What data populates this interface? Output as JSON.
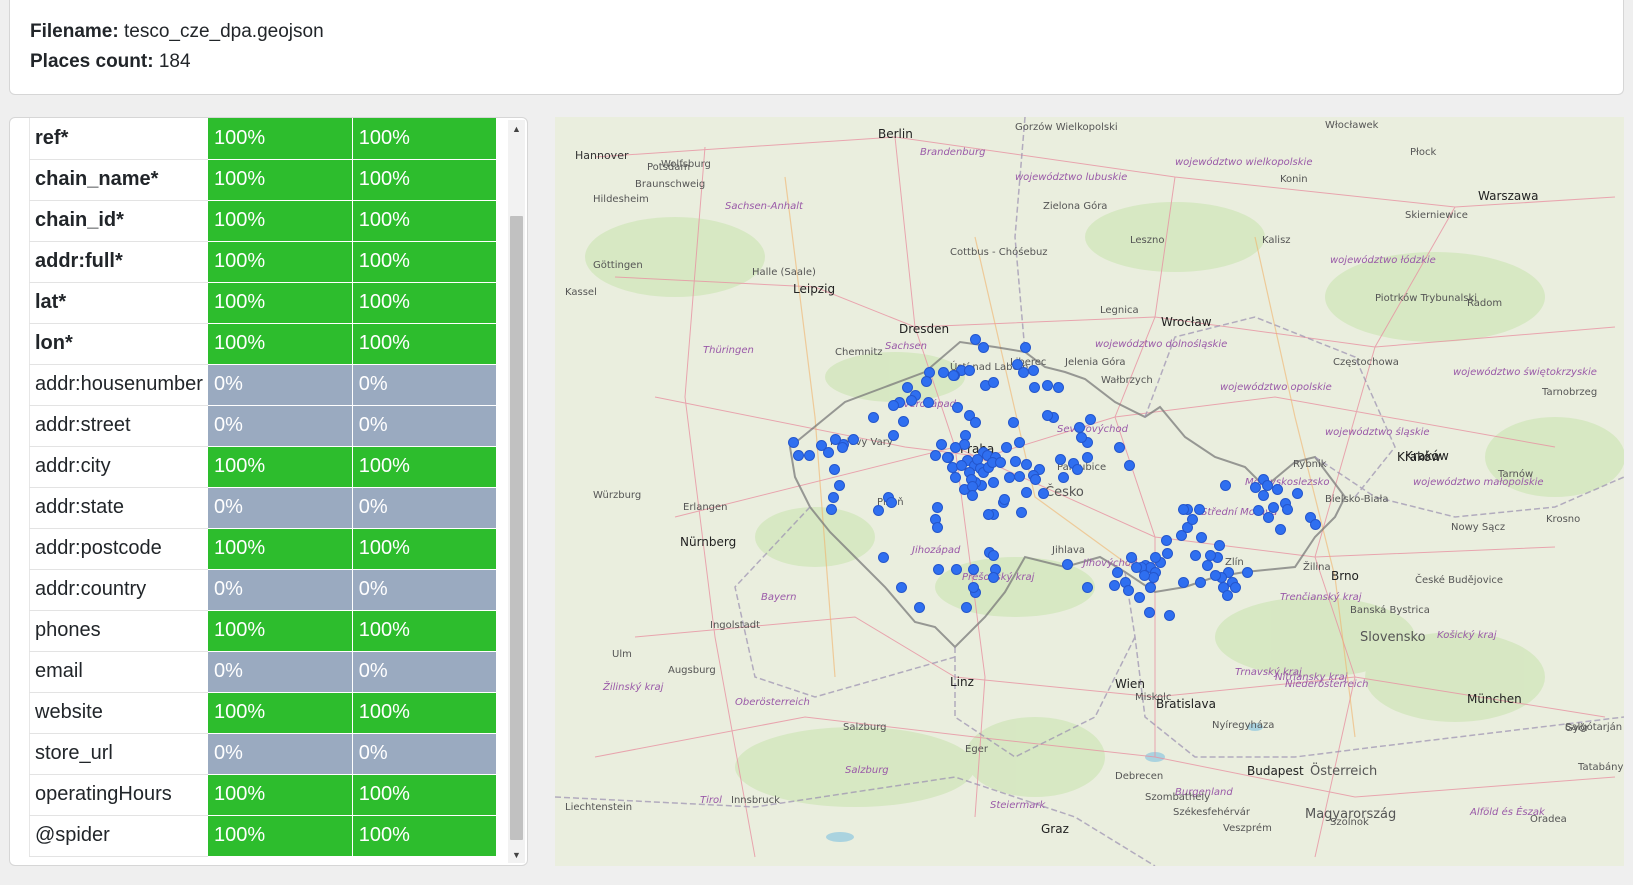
{
  "info": {
    "filename_label": "Filename:",
    "filename": "tesco_cze_dpa.geojson",
    "count_label": "Places count:",
    "count": "184"
  },
  "table": {
    "rows": [
      {
        "field": "ref*",
        "required": true,
        "a": "100%",
        "b": "100%",
        "status": "ok"
      },
      {
        "field": "chain_name*",
        "required": true,
        "a": "100%",
        "b": "100%",
        "status": "ok"
      },
      {
        "field": "chain_id*",
        "required": true,
        "a": "100%",
        "b": "100%",
        "status": "ok"
      },
      {
        "field": "addr:full*",
        "required": true,
        "a": "100%",
        "b": "100%",
        "status": "ok"
      },
      {
        "field": "lat*",
        "required": true,
        "a": "100%",
        "b": "100%",
        "status": "ok"
      },
      {
        "field": "lon*",
        "required": true,
        "a": "100%",
        "b": "100%",
        "status": "ok"
      },
      {
        "field": "addr:housenumber",
        "required": false,
        "a": "0%",
        "b": "0%",
        "status": "none"
      },
      {
        "field": "addr:street",
        "required": false,
        "a": "0%",
        "b": "0%",
        "status": "none"
      },
      {
        "field": "addr:city",
        "required": false,
        "a": "100%",
        "b": "100%",
        "status": "ok"
      },
      {
        "field": "addr:state",
        "required": false,
        "a": "0%",
        "b": "0%",
        "status": "none"
      },
      {
        "field": "addr:postcode",
        "required": false,
        "a": "100%",
        "b": "100%",
        "status": "ok"
      },
      {
        "field": "addr:country",
        "required": false,
        "a": "0%",
        "b": "0%",
        "status": "none"
      },
      {
        "field": "phones",
        "required": false,
        "a": "100%",
        "b": "100%",
        "status": "ok"
      },
      {
        "field": "email",
        "required": false,
        "a": "0%",
        "b": "0%",
        "status": "none"
      },
      {
        "field": "website",
        "required": false,
        "a": "100%",
        "b": "100%",
        "status": "ok"
      },
      {
        "field": "store_url",
        "required": false,
        "a": "0%",
        "b": "0%",
        "status": "none"
      },
      {
        "field": "operatingHours",
        "required": false,
        "a": "100%",
        "b": "100%",
        "status": "ok"
      },
      {
        "field": "@spider",
        "required": false,
        "a": "100%",
        "b": "100%",
        "status": "ok"
      }
    ],
    "colors": {
      "ok": "#2dbd2d",
      "none": "#9aaac0"
    }
  },
  "scrollbar": {
    "up_icon": "▲",
    "down_icon": "▼"
  },
  "map": {
    "marker_color": "#2f6ff0",
    "labels": [
      {
        "text": "Berlin",
        "kind": "big"
      },
      {
        "text": "Hannover",
        "kind": "city"
      },
      {
        "text": "Wolfsburg",
        "kind": "town"
      },
      {
        "text": "Potsdam",
        "kind": "town"
      },
      {
        "text": "Brandenburg",
        "kind": "region"
      },
      {
        "text": "Gorzów Wielkopolski",
        "kind": "town"
      },
      {
        "text": "Włocławek",
        "kind": "town"
      },
      {
        "text": "Płock",
        "kind": "town"
      },
      {
        "text": "województwo wielkopolskie",
        "kind": "region"
      },
      {
        "text": "Konin",
        "kind": "town"
      },
      {
        "text": "Warszawa",
        "kind": "big"
      },
      {
        "text": "Braunschweig",
        "kind": "town"
      },
      {
        "text": "Hildesheim",
        "kind": "town"
      },
      {
        "text": "Sachsen-Anhalt",
        "kind": "region"
      },
      {
        "text": "województwo lubuskie",
        "kind": "region"
      },
      {
        "text": "Zielona Góra",
        "kind": "town"
      },
      {
        "text": "Skierniewice",
        "kind": "town"
      },
      {
        "text": "Kalisz",
        "kind": "town"
      },
      {
        "text": "Leszno",
        "kind": "town"
      },
      {
        "text": "Göttingen",
        "kind": "town"
      },
      {
        "text": "Halle (Saale)",
        "kind": "town"
      },
      {
        "text": "Cottbus - Chóśebuz",
        "kind": "town"
      },
      {
        "text": "województwo łódzkie",
        "kind": "region"
      },
      {
        "text": "Kassel",
        "kind": "town"
      },
      {
        "text": "Leipzig",
        "kind": "big"
      },
      {
        "text": "Piotrków Trybunalski",
        "kind": "town"
      },
      {
        "text": "Radom",
        "kind": "town"
      },
      {
        "text": "Legnica",
        "kind": "town"
      },
      {
        "text": "Wrocław",
        "kind": "big"
      },
      {
        "text": "Dresden",
        "kind": "big"
      },
      {
        "text": "Sachsen",
        "kind": "region"
      },
      {
        "text": "Thüringen",
        "kind": "region"
      },
      {
        "text": "Chemnitz",
        "kind": "town"
      },
      {
        "text": "województwo dolnośląskie",
        "kind": "region"
      },
      {
        "text": "Liberec",
        "kind": "town"
      },
      {
        "text": "Jelenia Góra",
        "kind": "town"
      },
      {
        "text": "Częstochowa",
        "kind": "town"
      },
      {
        "text": "Ústí nad Labem",
        "kind": "town"
      },
      {
        "text": "Wałbrzych",
        "kind": "town"
      },
      {
        "text": "województwo świętokrzyskie",
        "kind": "region"
      },
      {
        "text": "województwo opolskie",
        "kind": "region"
      },
      {
        "text": "Tarnobrzeg",
        "kind": "town"
      },
      {
        "text": "Severozápad",
        "kind": "region"
      },
      {
        "text": "Severovýchod",
        "kind": "region"
      },
      {
        "text": "Karlovy Vary",
        "kind": "town"
      },
      {
        "text": "Praha",
        "kind": "big"
      },
      {
        "text": "województwo śląskie",
        "kind": "region"
      },
      {
        "text": "Kraków",
        "kind": "big"
      },
      {
        "text": "Pardubice",
        "kind": "town"
      },
      {
        "text": "Rybnik",
        "kind": "town"
      },
      {
        "text": "Tarnów",
        "kind": "town"
      },
      {
        "text": "Würzburg",
        "kind": "town"
      },
      {
        "text": "Česko",
        "kind": "country"
      },
      {
        "text": "Moravskoslezsko",
        "kind": "region"
      },
      {
        "text": "województwo małopolskie",
        "kind": "region"
      },
      {
        "text": "Erlangen",
        "kind": "town"
      },
      {
        "text": "Plzeň",
        "kind": "town"
      },
      {
        "text": "Bielsko-Biała",
        "kind": "town"
      },
      {
        "text": "Střední Morava",
        "kind": "region"
      },
      {
        "text": "Krosno",
        "kind": "town"
      },
      {
        "text": "Nowy Sącz",
        "kind": "town"
      },
      {
        "text": "Nürnberg",
        "kind": "big"
      },
      {
        "text": "Jihozápad",
        "kind": "region"
      },
      {
        "text": "Jihlava",
        "kind": "town"
      },
      {
        "text": "Jihovýchod",
        "kind": "region"
      },
      {
        "text": "Zlín",
        "kind": "town"
      },
      {
        "text": "Žilina",
        "kind": "town"
      },
      {
        "text": "Brno",
        "kind": "big"
      },
      {
        "text": "České Budějovice",
        "kind": "town"
      },
      {
        "text": "Žilinský kraj",
        "kind": "region"
      },
      {
        "text": "Prešovský kraj",
        "kind": "region"
      },
      {
        "text": "Bayern",
        "kind": "region"
      },
      {
        "text": "Trenčianský kraj",
        "kind": "region"
      },
      {
        "text": "Banská Bystrica",
        "kind": "town"
      },
      {
        "text": "Ingolstadt",
        "kind": "town"
      },
      {
        "text": "Slovensko",
        "kind": "country"
      },
      {
        "text": "Košický kraj",
        "kind": "region"
      },
      {
        "text": "Ulm",
        "kind": "town"
      },
      {
        "text": "Augsburg",
        "kind": "town"
      },
      {
        "text": "Trnavský kraj",
        "kind": "region"
      },
      {
        "text": "Nitriansky kraj",
        "kind": "region"
      },
      {
        "text": "Linz",
        "kind": "big"
      },
      {
        "text": "Wien",
        "kind": "big"
      },
      {
        "text": "Niederösterreich",
        "kind": "region"
      },
      {
        "text": "Miskolc",
        "kind": "town"
      },
      {
        "text": "München",
        "kind": "big"
      },
      {
        "text": "Oberösterreich",
        "kind": "region"
      },
      {
        "text": "Bratislava",
        "kind": "big"
      },
      {
        "text": "Salgótarján",
        "kind": "town"
      },
      {
        "text": "Salzburg",
        "kind": "town"
      },
      {
        "text": "Nyíregyháza",
        "kind": "town"
      },
      {
        "text": "Győr",
        "kind": "town"
      },
      {
        "text": "Eger",
        "kind": "town"
      },
      {
        "text": "Österreich",
        "kind": "country"
      },
      {
        "text": "Budapest",
        "kind": "big"
      },
      {
        "text": "Debrecen",
        "kind": "town"
      },
      {
        "text": "Tatabánya",
        "kind": "town"
      },
      {
        "text": "Burgenland",
        "kind": "region"
      },
      {
        "text": "Salzburg",
        "kind": "region"
      },
      {
        "text": "Tirol",
        "kind": "region"
      },
      {
        "text": "Innsbruck",
        "kind": "town"
      },
      {
        "text": "Szombathely",
        "kind": "town"
      },
      {
        "text": "Steiermark",
        "kind": "region"
      },
      {
        "text": "Székesfehérvár",
        "kind": "town"
      },
      {
        "text": "Magyarország",
        "kind": "country"
      },
      {
        "text": "Alföld és Észak",
        "kind": "region"
      },
      {
        "text": "Graz",
        "kind": "big"
      },
      {
        "text": "Veszprém",
        "kind": "town"
      },
      {
        "text": "Szolnok",
        "kind": "town"
      },
      {
        "text": "Oradea",
        "kind": "town"
      },
      {
        "text": "Liechtenstein",
        "kind": "town"
      },
      {
        "text": "Kraków",
        "kind": "big"
      }
    ]
  }
}
